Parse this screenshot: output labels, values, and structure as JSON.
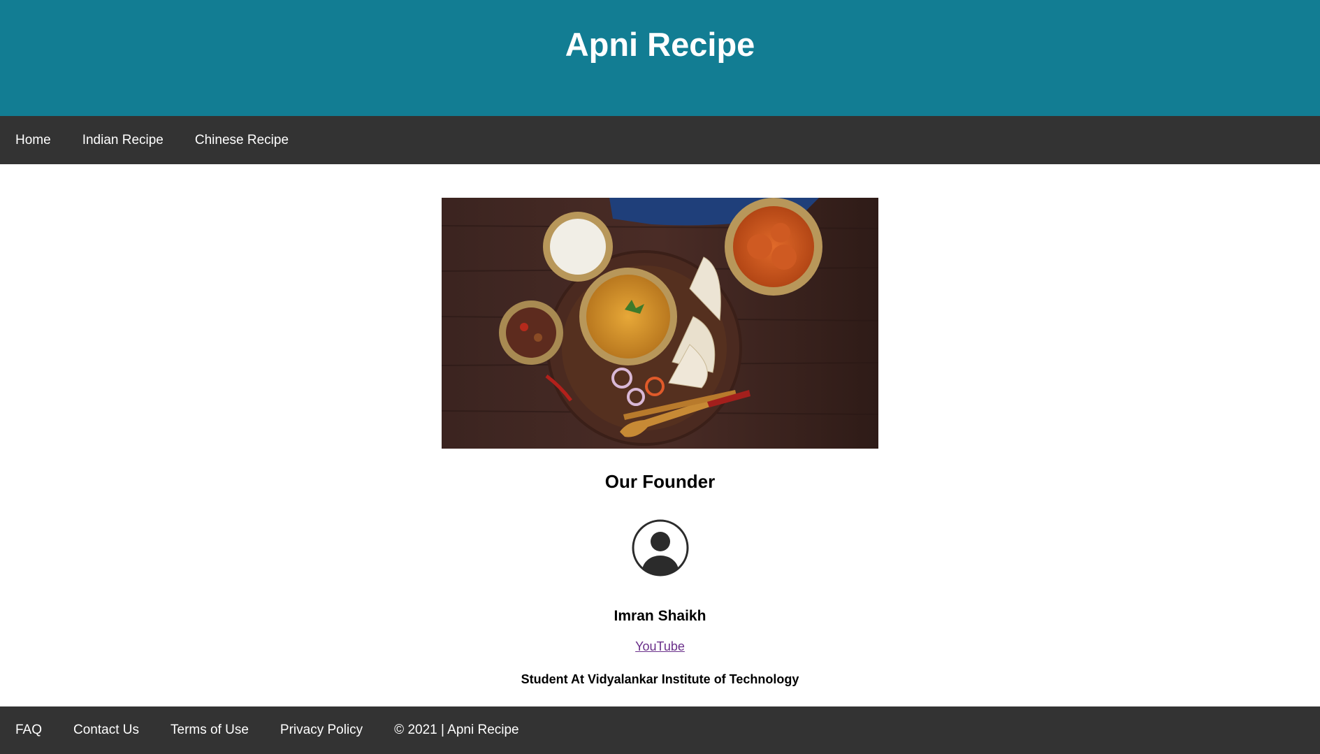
{
  "header": {
    "title": "Apni Recipe"
  },
  "nav": {
    "items": [
      {
        "label": "Home"
      },
      {
        "label": "Indian Recipe"
      },
      {
        "label": "Chinese Recipe"
      }
    ]
  },
  "main": {
    "hero_image": "indian-food-spread-photo",
    "founder_heading": "Our Founder",
    "avatar_icon": "user-circle-icon",
    "founder_name": "Imran Shaikh",
    "youtube_label": "YouTube",
    "founder_role": "Student At Vidyalankar Institute of Technology"
  },
  "footer": {
    "links": [
      {
        "label": "FAQ"
      },
      {
        "label": "Contact Us"
      },
      {
        "label": "Terms of Use"
      },
      {
        "label": "Privacy Policy"
      }
    ],
    "copyright": "© 2021 | Apni Recipe"
  },
  "colors": {
    "header_bg": "#127d93",
    "nav_bg": "#333333",
    "link_visited": "#6a2f8a"
  }
}
